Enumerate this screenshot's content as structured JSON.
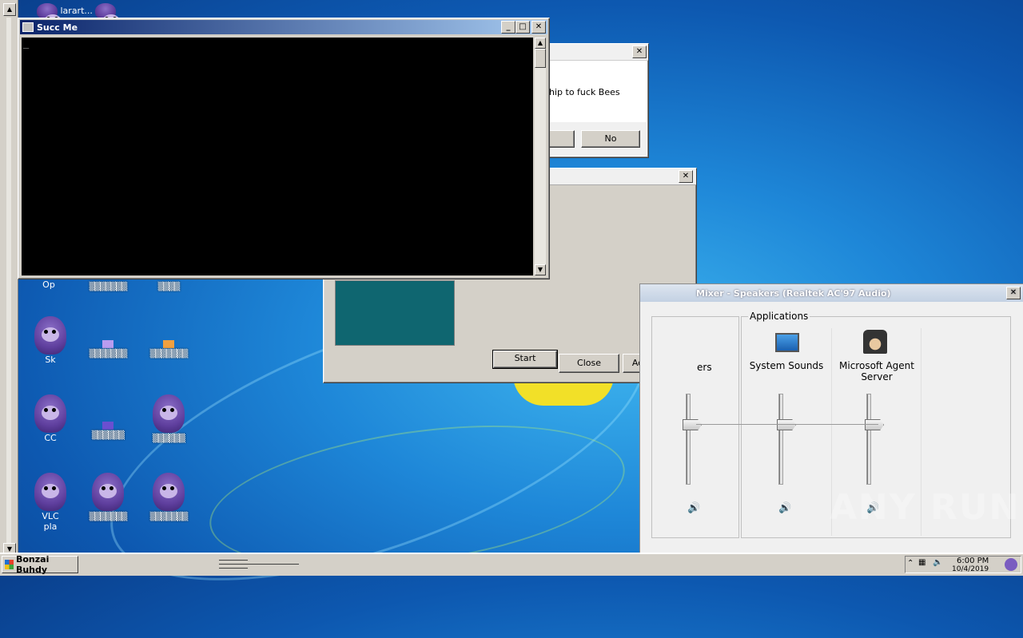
{
  "desktop": {
    "top_icon_label": "larart...",
    "icons": [
      {
        "label": "Op"
      },
      {
        "label": "Sk"
      },
      {
        "label": "CC"
      },
      {
        "label": "VLC pla"
      }
    ]
  },
  "dialog_back": {
    "message": "hip to fuck Bees",
    "no_label": "No",
    "close_glyph": "✕"
  },
  "dialog_mid": {
    "close_glyph": "✕",
    "start_label": "Start",
    "close_label": "Close",
    "advanced_label": "Advanced"
  },
  "console": {
    "title": "Succ Me",
    "cursor": "_",
    "minimize_glyph": "_",
    "maximize_glyph": "□",
    "close_glyph": "✕"
  },
  "mixer": {
    "title": "Mixer - Speakers (Realtek AC'97 Audio)",
    "close_glyph": "✕",
    "applications_label": "Applications",
    "device_label_partial": "ers",
    "apps": [
      {
        "name": "System Sounds"
      },
      {
        "name": "Microsoft Agent Server"
      }
    ]
  },
  "taskbar": {
    "start_label": "Bonzai Buhdy",
    "clock_time": "6:00 PM",
    "clock_date": "10/4/2019"
  },
  "watermark": "ANY RUN"
}
